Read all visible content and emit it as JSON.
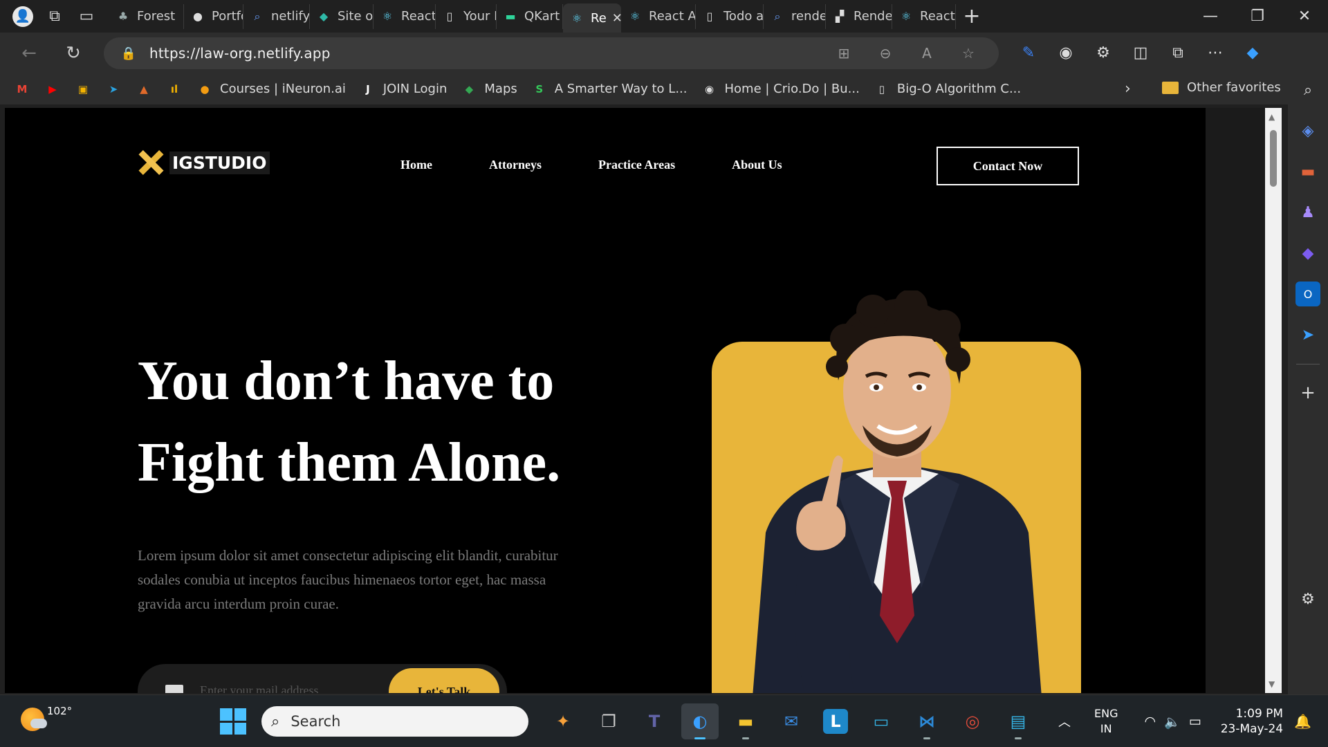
{
  "browser": {
    "tabs": [
      {
        "label": "Forest",
        "icon": "forest-icon",
        "color": "#9aa"
      },
      {
        "label": "Portfoli",
        "icon": "github-icon",
        "color": "#ddd"
      },
      {
        "label": "netlify",
        "icon": "search-icon",
        "color": "#6aa0ff"
      },
      {
        "label": "Site ov",
        "icon": "netlify-icon",
        "color": "#2fb9a7"
      },
      {
        "label": "React A",
        "icon": "react-icon",
        "color": "#61dafb"
      },
      {
        "label": "Your N",
        "icon": "page-icon",
        "color": "#ddd"
      },
      {
        "label": "QKart",
        "icon": "qkart-icon",
        "color": "#2fd49a"
      },
      {
        "label": "Re",
        "icon": "react-icon",
        "color": "#61dafb",
        "active": true
      },
      {
        "label": "React A",
        "icon": "react-icon",
        "color": "#61dafb"
      },
      {
        "label": "Todo a",
        "icon": "page-icon",
        "color": "#ddd"
      },
      {
        "label": "render",
        "icon": "search-icon",
        "color": "#6aa0ff"
      },
      {
        "label": "Render",
        "icon": "render-icon",
        "color": "#ddd"
      },
      {
        "label": "React A",
        "icon": "react-icon",
        "color": "#61dafb"
      }
    ],
    "url": "https://law-org.netlify.app",
    "bookmarks": [
      {
        "label": "",
        "icon": "gmail-icon",
        "glyph": "M",
        "color": "#ea4335"
      },
      {
        "label": "",
        "icon": "youtube-icon",
        "glyph": "▶",
        "color": "#ff0000"
      },
      {
        "label": "",
        "icon": "classroom-icon",
        "glyph": "▣",
        "color": "#f4b400"
      },
      {
        "label": "",
        "icon": "telegram-icon",
        "glyph": "➤",
        "color": "#2aa3e0"
      },
      {
        "label": "",
        "icon": "triangle-icon",
        "glyph": "▲",
        "color": "#e06a2a"
      },
      {
        "label": "",
        "icon": "bars-icon",
        "glyph": "ıl",
        "color": "#f4b400"
      },
      {
        "label": "Courses | iNeuron.ai",
        "icon": "ineuron-icon",
        "glyph": "●",
        "color": "#f39c12"
      },
      {
        "label": "JOIN Login",
        "icon": "join-icon",
        "glyph": "J",
        "color": "#ffffff"
      },
      {
        "label": "Maps",
        "icon": "maps-icon",
        "glyph": "◆",
        "color": "#34a853"
      },
      {
        "label": "A Smarter Way to L...",
        "icon": "dollar-icon",
        "glyph": "S",
        "color": "#34c759"
      },
      {
        "label": "Home | Crio.Do | Bu...",
        "icon": "crio-icon",
        "glyph": "◉",
        "color": "#dddddd"
      },
      {
        "label": "Big-O Algorithm C...",
        "icon": "page-icon",
        "glyph": "▯",
        "color": "#dddddd"
      }
    ],
    "other_favorites": "Other favorites"
  },
  "site": {
    "logo": "IGSTUDIO",
    "nav": [
      "Home",
      "Attorneys",
      "Practice Areas",
      "About Us"
    ],
    "contact_button": "Contact Now",
    "hero_line1": "You don’t have to",
    "hero_line2": "Fight them Alone.",
    "hero_paragraph": "Lorem ipsum dolor sit amet consectetur adipiscing elit blandit, curabitur sodales conubia ut inceptos faucibus himenaeos tortor eget, hac massa gravida arcu interdum proin curae.",
    "email_placeholder": "Enter your mail address",
    "subscribe_button": "Let's Talk",
    "accent_color": "#e8b53a"
  },
  "taskbar": {
    "temperature": "102°",
    "search_placeholder": "Search",
    "language_line1": "ENG",
    "language_line2": "IN",
    "time": "1:09 PM",
    "date": "23-May-24"
  }
}
